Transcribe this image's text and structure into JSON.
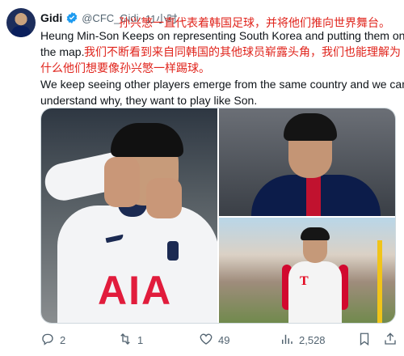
{
  "tweet": {
    "author_name": "Gidi",
    "handle": "@CFC_Gidi",
    "separator": "·",
    "time": "11小时",
    "text_lines_1": [
      "Heung Min-Son Keeps on representing South Korea and putting them on",
      "the map."
    ],
    "text_lines_2": [
      "We keep seeing other players emerge from the same country and we can",
      "understand why, they want to play like Son."
    ],
    "translation_lines": [
      "孙兴慜一直代表着韩国足球，并将他们推向世界舞台。",
      "我们不断看到来自同韩国的其他球员崭露头角，我们也能理解为",
      "什么他们想要像孙兴慜一样踢球。"
    ],
    "media_left_shirt_text": "AIA",
    "media_br_logo": "T"
  },
  "actions": {
    "replies": "2",
    "retweets": "1",
    "likes": "49",
    "views": "2,528"
  },
  "icons": {
    "verified": "verified-badge-icon",
    "reply": "reply-icon",
    "retweet": "retweet-icon",
    "like": "heart-icon",
    "views": "views-bar-chart-icon",
    "bookmark": "bookmark-icon",
    "share": "share-icon"
  },
  "colors": {
    "verified_blue": "#1d9bf0",
    "translation_red": "#e0241c",
    "secondary_text": "#536471"
  }
}
